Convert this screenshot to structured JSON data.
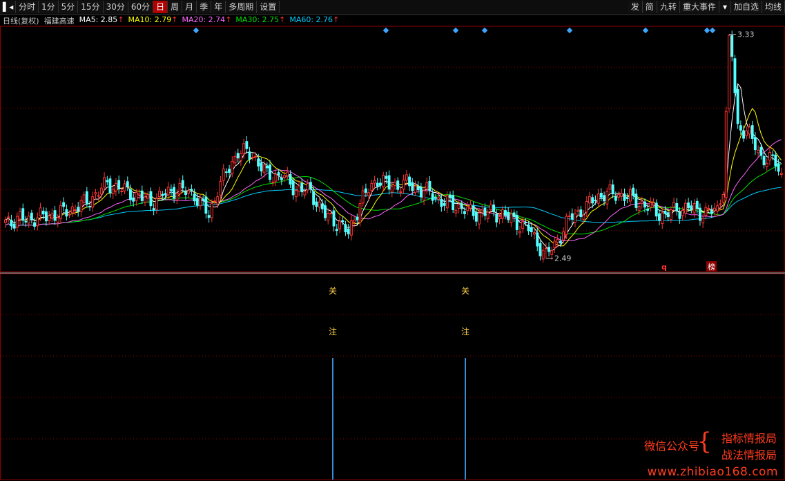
{
  "toolbar": {
    "left": [
      "分时",
      "1分",
      "5分",
      "15分",
      "30分",
      "60分",
      "日",
      "周",
      "月",
      "季",
      "年",
      "多周期",
      "设置"
    ],
    "active_index": 6,
    "right": [
      "发",
      "简",
      "九转",
      "重大事件",
      "加自选",
      "均线"
    ]
  },
  "legend": {
    "period": "日线(复权)",
    "stock_name": "福建高速",
    "items": [
      {
        "label": "MA5: 2.85",
        "arrow": "↑",
        "color": "#ffffff"
      },
      {
        "label": "MA10: 2.79",
        "arrow": "↑",
        "color": "#ffff00"
      },
      {
        "label": "MA20: 2.74",
        "arrow": "↑",
        "color": "#ff66ff"
      },
      {
        "label": "MA30: 2.75",
        "arrow": "↑",
        "color": "#00e000"
      },
      {
        "label": "MA60: 2.76",
        "arrow": "↑",
        "color": "#00ccff"
      }
    ]
  },
  "annotations": {
    "high_label": "3.33",
    "low_label": "2.49",
    "marker_q": "q",
    "marker_bang": "榜"
  },
  "subchart": {
    "char1": "关",
    "char2": "注"
  },
  "watermark": {
    "left_text": "微信公众号",
    "line1": "指标情报局",
    "line2": "战法情报局",
    "url": "www.zhibiao168.com"
  },
  "colors": {
    "up": "#ff3232",
    "down": "#54ffff",
    "active_tab": "#b00000",
    "grid": "#8b0000",
    "watermark": "#ff3c1e"
  }
}
